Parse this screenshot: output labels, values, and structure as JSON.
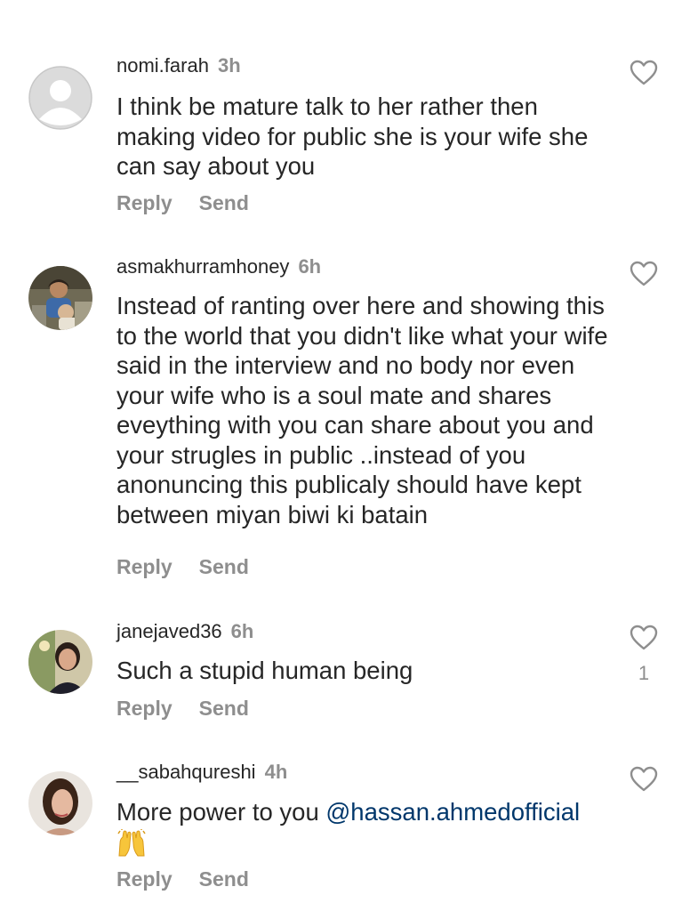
{
  "comments": [
    {
      "username": "nomi.farah",
      "time": "3h",
      "text": "I think be mature talk to her rather then making video for public she is your wife she can say about you",
      "reply_label": "Reply",
      "send_label": "Send",
      "likes": ""
    },
    {
      "username": "asmakhurramhoney",
      "time": "6h",
      "text": "Instead of ranting over here and showing this to the world that you didn't like what your wife said in the interview and no body nor even your wife who is a soul mate and shares eveything with you can share about you and your strugles in public ..instead of you anonuncing this publicaly should have kept between miyan biwi ki batain",
      "reply_label": "Reply",
      "send_label": "Send",
      "likes": ""
    },
    {
      "username": "janejaved36",
      "time": "6h",
      "text": "Such a stupid human being",
      "reply_label": "Reply",
      "send_label": "Send",
      "likes": "1"
    },
    {
      "username": "__sabahqureshi",
      "time": "4h",
      "text_prefix": "More power to you ",
      "mention": "@hassan.ahmedofficial",
      "emoji": "raising-hands",
      "reply_label": "Reply",
      "send_label": "Send",
      "likes": ""
    }
  ],
  "icons": {
    "like": "heart-outline-icon",
    "default_avatar": "default-avatar-icon"
  },
  "colors": {
    "text_primary": "#262626",
    "text_secondary": "#8e8e8e",
    "mention": "#00376b"
  }
}
